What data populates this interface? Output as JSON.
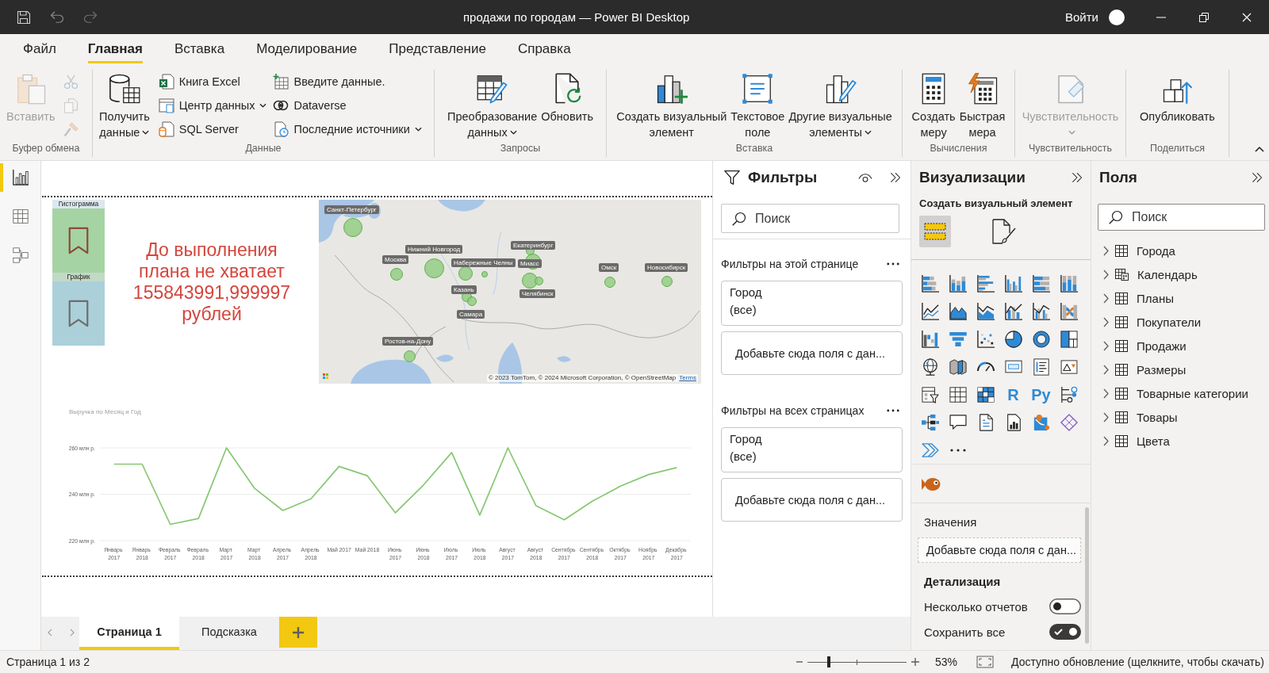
{
  "window": {
    "title": "продажи по городам — Power BI Desktop",
    "sign_in": "Войти"
  },
  "menu_tabs": [
    {
      "label": "Файл",
      "selected": false
    },
    {
      "label": "Главная",
      "selected": true
    },
    {
      "label": "Вставка",
      "selected": false
    },
    {
      "label": "Моделирование",
      "selected": false
    },
    {
      "label": "Представление",
      "selected": false
    },
    {
      "label": "Справка",
      "selected": false
    }
  ],
  "ribbon": {
    "groups": [
      {
        "label": "Буфер обмена",
        "buttons": [
          {
            "kind": "large",
            "label": "Вставить",
            "disabled": true,
            "dropdown": false
          },
          {
            "kind": "icon",
            "disabled": true
          },
          {
            "kind": "icon",
            "disabled": true
          },
          {
            "kind": "icon",
            "disabled": true
          }
        ]
      },
      {
        "label": "Данные",
        "buttons": [
          {
            "kind": "large",
            "label": "Получить данные",
            "disabled": false,
            "dropdown": true
          },
          {
            "kind": "small",
            "label": "Книга Excel",
            "disabled": false,
            "dropdown": false
          },
          {
            "kind": "small",
            "label": "Центр данных",
            "disabled": false,
            "dropdown": true
          },
          {
            "kind": "small",
            "label": "SQL Server",
            "disabled": false,
            "dropdown": false
          },
          {
            "kind": "small",
            "label": "Введите данные.",
            "disabled": false,
            "dropdown": false
          },
          {
            "kind": "small",
            "label": "Dataverse",
            "disabled": false,
            "dropdown": false
          },
          {
            "kind": "small",
            "label": "Последние источники",
            "disabled": false,
            "dropdown": true
          }
        ]
      },
      {
        "label": "Запросы",
        "buttons": [
          {
            "kind": "large",
            "label": "Преобразование данных",
            "disabled": false,
            "dropdown": true
          },
          {
            "kind": "large",
            "label": "Обновить",
            "disabled": false,
            "dropdown": false
          }
        ]
      },
      {
        "label": "Вставка",
        "buttons": [
          {
            "kind": "large",
            "label": "Создать визуальный элемент",
            "disabled": false,
            "dropdown": false
          },
          {
            "kind": "large",
            "label": "Текстовое поле",
            "disabled": false,
            "dropdown": false
          },
          {
            "kind": "large",
            "label": "Другие визуальные элементы",
            "disabled": false,
            "dropdown": true
          }
        ]
      },
      {
        "label": "Вычисления",
        "buttons": [
          {
            "kind": "large",
            "label": "Создать меру",
            "disabled": false,
            "dropdown": false
          },
          {
            "kind": "large",
            "label": "Быстрая мера",
            "disabled": false,
            "dropdown": false
          }
        ]
      },
      {
        "label": "Чувствительность",
        "buttons": [
          {
            "kind": "large",
            "label": "Чувствительность",
            "disabled": true,
            "dropdown": true
          }
        ]
      },
      {
        "label": "Поделиться",
        "buttons": [
          {
            "kind": "large",
            "label": "Опубликовать",
            "disabled": false,
            "dropdown": false
          }
        ]
      }
    ]
  },
  "views": [
    {
      "selected": true
    },
    {
      "selected": false
    },
    {
      "selected": false
    }
  ],
  "report": {
    "bookmarks": [
      {
        "label": "Гистограмма",
        "selected": true
      },
      {
        "label": "График",
        "selected": false
      }
    ],
    "text_box": "До выполнения плана не хватает 155843991,999997 рублей",
    "map": {
      "markers": [
        {
          "label": "Санкт-Петербург"
        },
        {
          "label": "Екатеринбург"
        },
        {
          "label": "Нижний Новгород"
        },
        {
          "label": "Москва"
        },
        {
          "label": "Набережные Челны"
        },
        {
          "label": "Миасс"
        },
        {
          "label": "Омск"
        },
        {
          "label": "Новосибирск"
        },
        {
          "label": "Казань"
        },
        {
          "label": "Челябинск"
        },
        {
          "label": "Самара"
        },
        {
          "label": "Ростов-на-Дону"
        }
      ],
      "attribution": "© 2023 TomTom, © 2024 Microsoft Corporation, © OpenStreetMap",
      "terms_link": "Terms"
    },
    "line_chart": {
      "chart_data": {
        "type": "line",
        "title": "Выручка по Месяц и Год",
        "categories": [
          "Январь 2017",
          "Январь 2018",
          "Февраль 2017",
          "Февраль 2018",
          "Март 2017",
          "Март 2018",
          "Апрель 2017",
          "Апрель 2018",
          "Май 2017",
          "Май 2018",
          "Июнь 2017",
          "Июнь 2018",
          "Июль 2017",
          "Июль 2018",
          "Август 2017",
          "Август 2018",
          "Сентябрь 2017",
          "Сентябрь 2018",
          "Октябрь 2017",
          "Ноябрь 2017",
          "Декабрь 2017"
        ],
        "values": [
          253,
          253,
          227,
          229.5,
          260,
          242.5,
          233,
          238,
          252,
          248,
          232,
          244,
          258,
          231,
          260,
          235,
          229,
          237,
          243.5,
          248.5,
          251.5
        ],
        "color": "#86c772",
        "ylim": [
          220,
          260
        ],
        "yticks": [
          {
            "value": 220,
            "label": "220 млн р."
          },
          {
            "value": 240,
            "label": "240 млн р."
          },
          {
            "value": 260,
            "label": "260 млн р."
          }
        ],
        "grid": true
      }
    }
  },
  "page_tabs": [
    {
      "label": "Страница 1",
      "selected": true
    },
    {
      "label": "Подсказка",
      "selected": false
    }
  ],
  "filters": {
    "title": "Фильтры",
    "search_placeholder": "Поиск",
    "sections": [
      {
        "title": "Фильтры на этой странице",
        "cards": [
          {
            "kind": "filter",
            "field": "Город",
            "value": "(все)"
          },
          {
            "kind": "drop",
            "hint": "Добавьте сюда поля с дан..."
          }
        ]
      },
      {
        "title": "Фильтры на всех страницах",
        "cards": [
          {
            "kind": "filter",
            "field": "Город",
            "value": "(все)"
          },
          {
            "kind": "drop",
            "hint": "Добавьте сюда поля с дан..."
          }
        ]
      }
    ]
  },
  "visualizations": {
    "title": "Визуализации",
    "subtitle": "Создать визуальный элемент",
    "modes": [
      {
        "selected": true
      },
      {
        "selected": false
      }
    ],
    "script_visuals": [
      "R",
      "Py"
    ],
    "wells": [
      {
        "label": "Значения",
        "hint": "Добавьте сюда поля с дан..."
      }
    ],
    "drillthrough": {
      "title": "Детализация",
      "options": [
        {
          "label": "Несколько отчетов",
          "on": false
        },
        {
          "label": "Сохранить все",
          "on": true
        }
      ]
    }
  },
  "fields": {
    "title": "Поля",
    "search_placeholder": "Поиск",
    "tables": [
      {
        "label": "Города",
        "kind": "table",
        "expanded": false
      },
      {
        "label": "Календарь",
        "kind": "date_table",
        "expanded": false
      },
      {
        "label": "Планы",
        "kind": "table",
        "expanded": false
      },
      {
        "label": "Покупатели",
        "kind": "table",
        "expanded": false
      },
      {
        "label": "Продажи",
        "kind": "table",
        "expanded": false
      },
      {
        "label": "Размеры",
        "kind": "table",
        "expanded": false
      },
      {
        "label": "Товарные категории",
        "kind": "table",
        "expanded": false
      },
      {
        "label": "Товары",
        "kind": "table",
        "expanded": false
      },
      {
        "label": "Цвета",
        "kind": "table",
        "expanded": false
      }
    ]
  },
  "status_bar": {
    "page": "Страница 1 из 2",
    "zoom": {
      "level": 0.22,
      "reading": "53%"
    },
    "update_notice": "Доступно обновление (щелкните, чтобы скачать)"
  }
}
